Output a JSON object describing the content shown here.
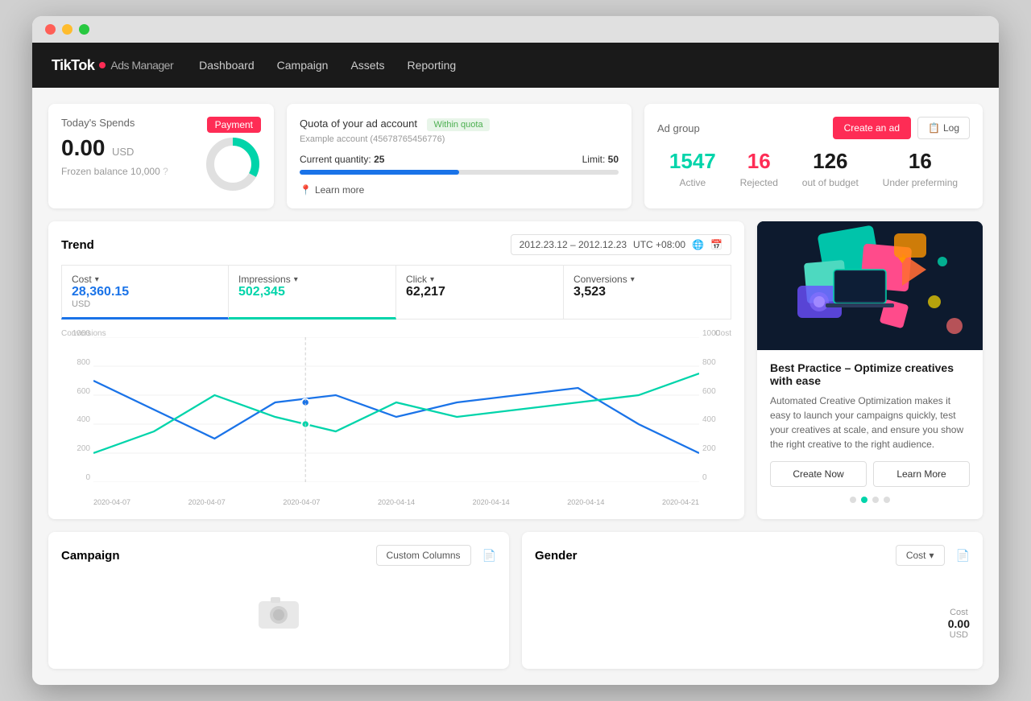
{
  "window": {
    "title": "TikTok Ads Manager"
  },
  "nav": {
    "logo_text": "TikTok",
    "logo_sub": "Ads Manager",
    "links": [
      "Dashboard",
      "Campaign",
      "Assets",
      "Reporting"
    ]
  },
  "spend_card": {
    "title": "Today's Spends",
    "payment_label": "Payment",
    "amount": "0.00",
    "currency": "USD",
    "frozen_label": "Frozen balance 10,000"
  },
  "quota_card": {
    "title": "Quota of your ad account",
    "status": "Within quota",
    "account": "Example account (45678765456776)",
    "current_label": "Current quantity:",
    "current_value": "25",
    "limit_label": "Limit:",
    "limit_value": "50",
    "progress_pct": 50,
    "learn_more": "Learn more"
  },
  "adgroup_card": {
    "title": "Ad group",
    "create_ad_label": "Create an ad",
    "log_label": "Log",
    "stats": [
      {
        "value": "1547",
        "label": "Active",
        "color": "teal"
      },
      {
        "value": "16",
        "label": "Rejected",
        "color": "red"
      },
      {
        "value": "126",
        "label": "out of budget",
        "color": "dark"
      },
      {
        "value": "16",
        "label": "Under preferming",
        "color": "dark"
      }
    ]
  },
  "trend": {
    "title": "Trend",
    "date_range": "2012.23.12 – 2012.12.23",
    "timezone": "UTC +08:00",
    "metrics": [
      {
        "label": "Cost",
        "value": "28,360.15",
        "unit": "USD",
        "color": "blue"
      },
      {
        "label": "Impressions",
        "value": "502,345",
        "color": "teal"
      },
      {
        "label": "Click",
        "value": "62,217",
        "color": "dark"
      },
      {
        "label": "Conversions",
        "value": "3,523",
        "color": "dark"
      }
    ],
    "y_labels_left": [
      "1000",
      "800",
      "600",
      "400",
      "200",
      "0"
    ],
    "y_labels_right": [
      "1000",
      "800",
      "600",
      "400",
      "200",
      "0"
    ],
    "left_axis": "Conversions",
    "right_axis": "Cost",
    "x_labels": [
      "2020-04-07",
      "2020-04-07",
      "2020-04-07",
      "2020-04-14",
      "2020-04-14",
      "2020-04-14",
      "2020-04-21"
    ]
  },
  "promo": {
    "title": "Best Practice – Optimize creatives with ease",
    "description": "Automated Creative Optimization makes it easy to launch your campaigns quickly, test your creatives at scale, and ensure you show the right creative to the right audience.",
    "create_now": "Create Now",
    "learn_more": "Learn More",
    "dots": [
      false,
      true,
      false,
      false
    ]
  },
  "campaign_section": {
    "title": "Campaign",
    "custom_columns_label": "Custom Columns"
  },
  "gender_section": {
    "title": "Gender",
    "cost_label": "Cost",
    "cost_value": "0.00",
    "cost_currency": "USD"
  }
}
